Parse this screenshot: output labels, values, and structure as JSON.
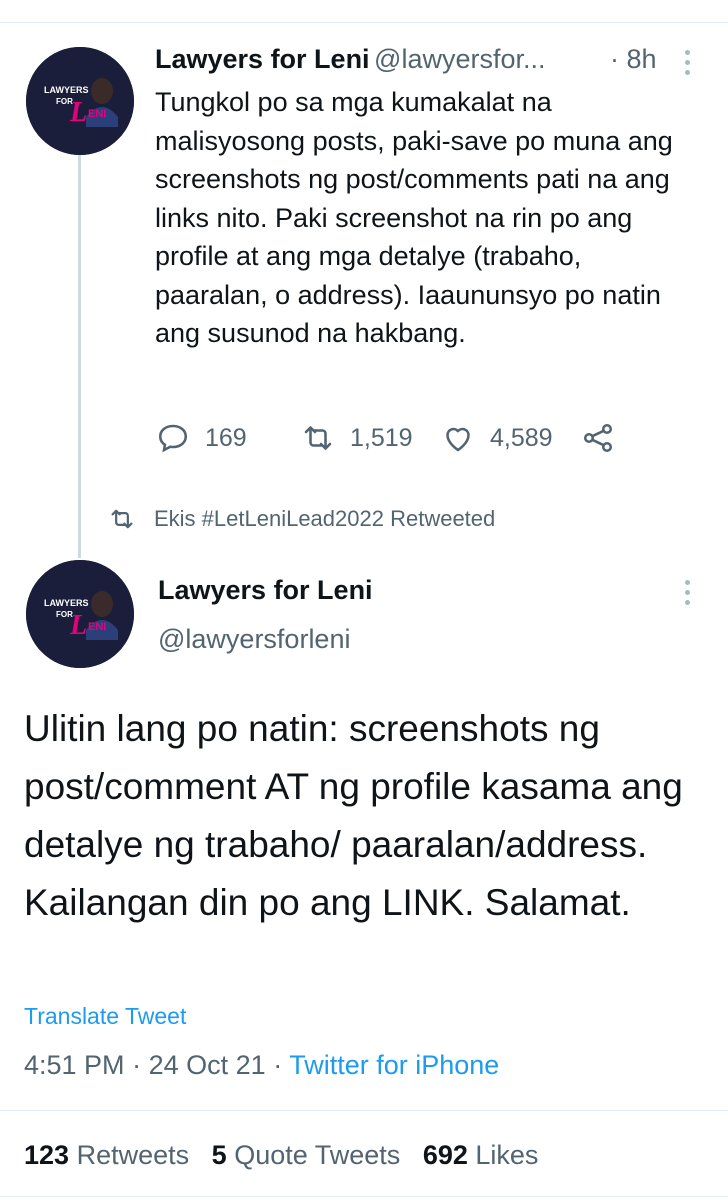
{
  "tweet1": {
    "name": "Lawyers for Leni",
    "handle": "@lawyersfor...",
    "time": "· 8h",
    "text": "Tungkol po sa mga kumakalat na malisyosong posts, paki-save po muna ang screenshots ng post/comments pati na ang links nito. Paki screenshot na rin po ang profile at ang mga detalye (trabaho, paaralan, o address). Iaaununsyo po natin ang susunod na hakbang.",
    "replies": "169",
    "retweets": "1,519",
    "likes": "4,589"
  },
  "avatar": {
    "line1": "LAWYERS",
    "line2": "FOR",
    "line3": "LENI",
    "accent": "#e6007e",
    "bg": "#1b1e3a"
  },
  "retweet_context": {
    "text": "Ekis #LetLeniLead2022 Retweeted"
  },
  "tweet2": {
    "name": "Lawyers for Leni",
    "handle": "@lawyersforleni",
    "text": "Ulitin lang po natin: screenshots ng post/comment AT ng profile kasama ang detalye ng trabaho/ paaralan/address. Kailangan din po ang LINK. Salamat.",
    "translate": "Translate Tweet",
    "time": "4:51 PM",
    "date": "24 Oct 21",
    "separator": "·",
    "source": "Twitter for iPhone",
    "stats": {
      "retweets_count": "123",
      "retweets_label": "Retweets",
      "quotes_count": "5",
      "quotes_label": "Quote Tweets",
      "likes_count": "692",
      "likes_label": "Likes"
    }
  },
  "icons": [
    "reply-icon",
    "retweet-icon",
    "like-icon",
    "share-icon",
    "more-icon"
  ]
}
